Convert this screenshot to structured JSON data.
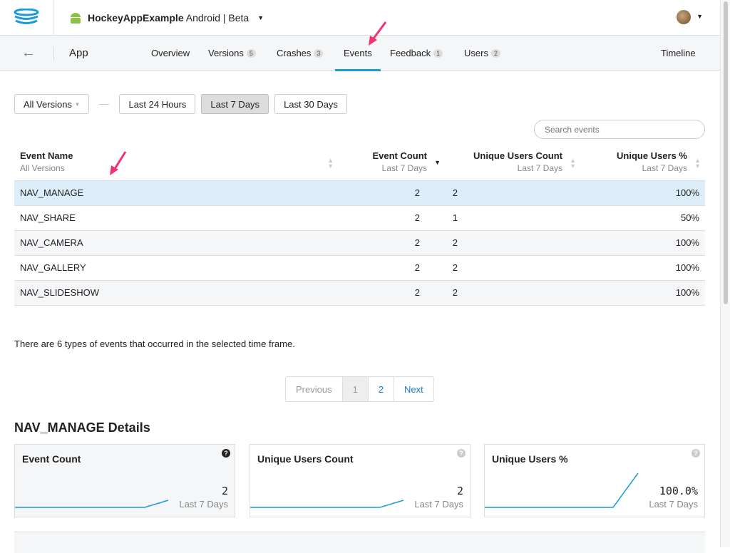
{
  "header": {
    "app_name": "HockeyAppExample",
    "platform": "Android",
    "channel": "Beta"
  },
  "nav": {
    "section": "App",
    "tabs": [
      {
        "label": "Overview"
      },
      {
        "label": "Versions",
        "badge": "5"
      },
      {
        "label": "Crashes",
        "badge": "3"
      },
      {
        "label": "Events"
      },
      {
        "label": "Feedback",
        "badge": "1"
      },
      {
        "label": "Users",
        "badge": "2"
      }
    ],
    "timeline": "Timeline"
  },
  "filters": {
    "version": "All Versions",
    "ranges": [
      "Last 24 Hours",
      "Last 7 Days",
      "Last 30 Days"
    ],
    "selected": "Last 7 Days"
  },
  "search": {
    "placeholder": "Search events"
  },
  "table": {
    "headers": [
      {
        "title": "Event Name",
        "sub": "All Versions"
      },
      {
        "title": "Event Count",
        "sub": "Last 7 Days"
      },
      {
        "title": "Unique Users Count",
        "sub": "Last 7 Days"
      },
      {
        "title": "Unique Users %",
        "sub": "Last 7 Days"
      }
    ],
    "rows": [
      [
        "NAV_MANAGE",
        "2",
        "2",
        "100%"
      ],
      [
        "NAV_SHARE",
        "2",
        "1",
        "50%"
      ],
      [
        "NAV_CAMERA",
        "2",
        "2",
        "100%"
      ],
      [
        "NAV_GALLERY",
        "2",
        "2",
        "100%"
      ],
      [
        "NAV_SLIDESHOW",
        "2",
        "2",
        "100%"
      ]
    ]
  },
  "info": "There are 6 types of events that occurred in the selected time frame.",
  "pager": {
    "prev": "Previous",
    "pages": [
      "1",
      "2"
    ],
    "next": "Next"
  },
  "details": {
    "title": "NAV_MANAGE Details",
    "cards": [
      {
        "title": "Event Count",
        "value": "2",
        "period": "Last 7 Days"
      },
      {
        "title": "Unique Users Count",
        "value": "2",
        "period": "Last 7 Days"
      },
      {
        "title": "Unique Users %",
        "value": "100.0%",
        "period": "Last 7 Days"
      }
    ]
  },
  "colors": {
    "accent": "#1a9ad6",
    "annotation": "#f0326e"
  }
}
